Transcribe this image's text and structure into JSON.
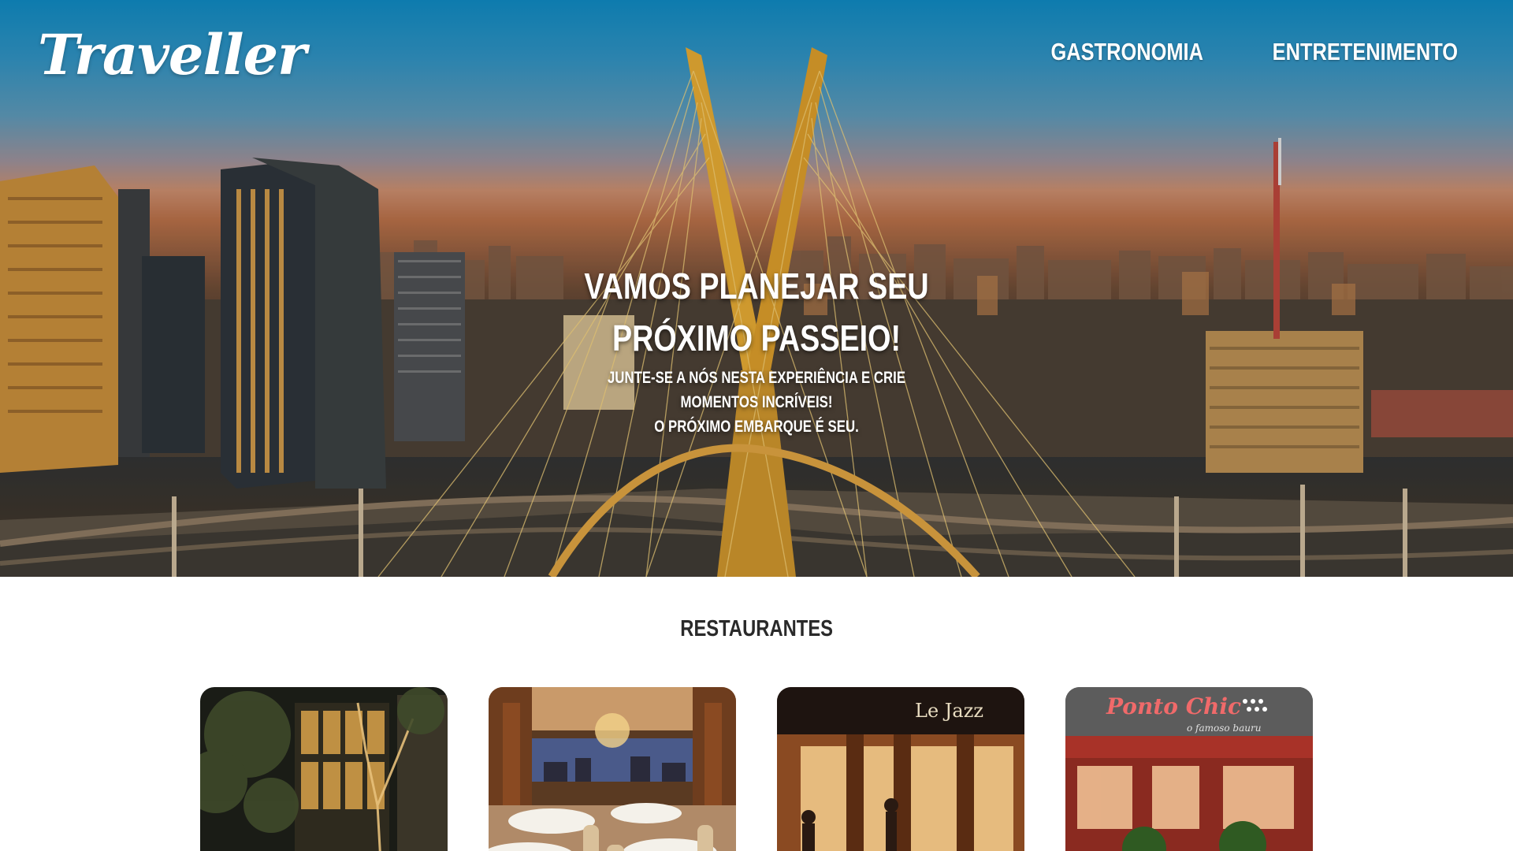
{
  "header": {
    "logo": "Traveller",
    "nav": [
      {
        "label": "Gastronomia"
      },
      {
        "label": "Entretenimento"
      }
    ]
  },
  "hero": {
    "title": "Vamos planejar seu próximo passeio!",
    "subtitle_line1": "Junte-se a nós nesta experiência e crie momentos incríveis!",
    "subtitle_line2": "O próximo embarque é seu."
  },
  "restaurants": {
    "title": "Restaurantes",
    "cards": [
      {
        "name": "restaurant-1",
        "sign": ""
      },
      {
        "name": "restaurant-2",
        "sign": ""
      },
      {
        "name": "restaurant-3",
        "sign": "Le Jazz"
      },
      {
        "name": "restaurant-4",
        "sign": "Ponto Chic",
        "sign_sub": "o famoso bauru"
      }
    ]
  },
  "colors": {
    "hero_sky_top": "#0f86bd",
    "hero_sunset": "#c68a6c",
    "text_white": "#ffffff",
    "section_title": "#2a2a2a",
    "bridge_gold": "#e0a632"
  }
}
